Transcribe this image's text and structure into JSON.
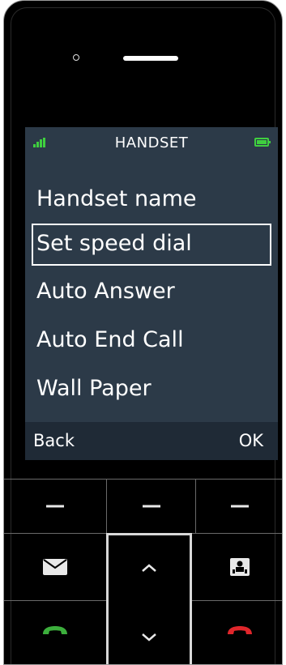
{
  "screen": {
    "title": "HANDSET",
    "menu_items": [
      {
        "label": "Handset name",
        "selected": false
      },
      {
        "label": "Set speed dial",
        "selected": true
      },
      {
        "label": "Auto Answer",
        "selected": false
      },
      {
        "label": "Auto End Call",
        "selected": false
      },
      {
        "label": "Wall Paper",
        "selected": false
      }
    ],
    "softkeys": {
      "left": "Back",
      "right": "OK"
    }
  },
  "icons": {
    "signal": "signal-strength-icon",
    "battery": "battery-icon",
    "messages": "envelope-icon",
    "contacts": "contact-book-icon",
    "nav_up": "chevron-up-icon",
    "nav_down": "chevron-down-icon",
    "call": "call-green-handset-icon",
    "end_call": "end-call-red-handset-icon"
  },
  "colors": {
    "screen_bg": "#2c3a48",
    "softkey_bar_bg": "#1f2a36",
    "status_green": "#3fcf3f",
    "call_green": "#3cae3c",
    "end_red": "#e0262b",
    "phone_body": "#000000"
  }
}
